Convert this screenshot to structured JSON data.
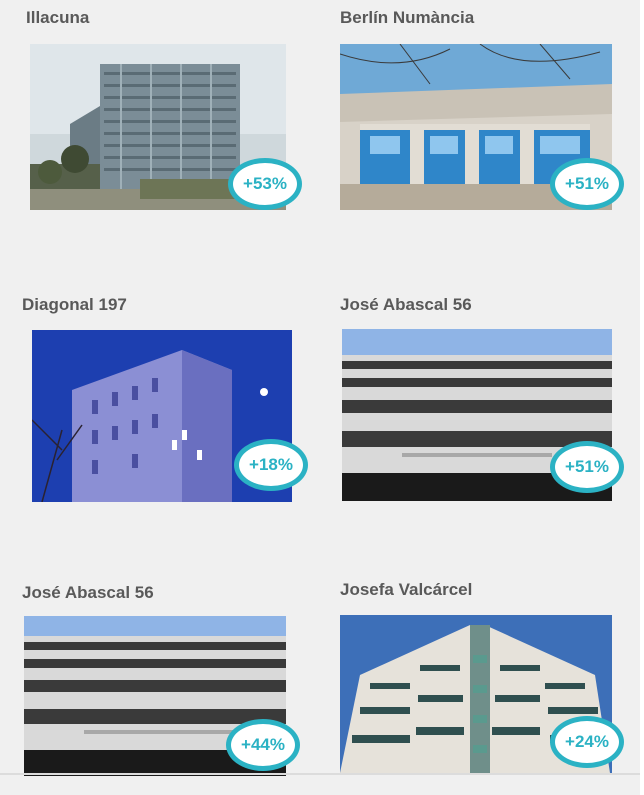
{
  "accent_color": "#2bb2c4",
  "properties": [
    {
      "name": "Illacuna",
      "change": "+53%",
      "image": "office-tower-with-palms-photo"
    },
    {
      "name": "Berlín Numància",
      "change": "+51%",
      "image": "blue-glass-facade-upward-photo"
    },
    {
      "name": "Diagonal 197",
      "change": "+18%",
      "image": "lit-building-at-dusk-photo"
    },
    {
      "name": "José Abascal 56",
      "change": "+51%",
      "image": "horizontal-bands-facade-photo"
    },
    {
      "name": "José Abascal 56",
      "change": "+44%",
      "image": "horizontal-bands-facade-photo"
    },
    {
      "name": "Josefa Valcárcel",
      "change": "+24%",
      "image": "white-tower-upward-photo"
    }
  ]
}
